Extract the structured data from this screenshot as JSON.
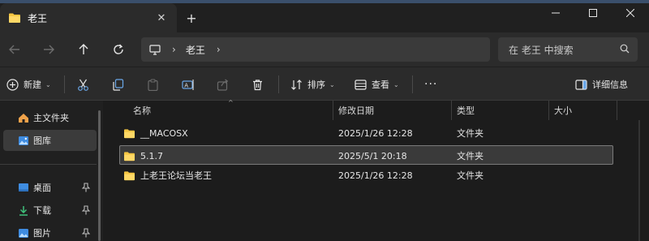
{
  "window": {
    "tab_title": "老王"
  },
  "navigation": {
    "breadcrumb": [
      "老王"
    ],
    "search_placeholder": "在 老王 中搜索"
  },
  "command_bar": {
    "new_label": "新建",
    "sort_label": "排序",
    "view_label": "查看",
    "more_label": "···",
    "details_label": "详细信息"
  },
  "sidebar": {
    "items": [
      {
        "label": "主文件夹",
        "icon": "home-icon"
      },
      {
        "label": "图库",
        "icon": "gallery-icon"
      },
      {
        "label": "桌面",
        "icon": "desktop-icon",
        "pinned": true
      },
      {
        "label": "下载",
        "icon": "download-icon",
        "pinned": true
      },
      {
        "label": "图片",
        "icon": "pictures-icon",
        "pinned": true
      }
    ]
  },
  "file_list": {
    "columns": [
      "名称",
      "修改日期",
      "类型",
      "大小"
    ],
    "rows": [
      {
        "name": "__MACOSX",
        "modified": "2025/1/26 12:28",
        "type": "文件夹",
        "size": "",
        "selected": false
      },
      {
        "name": "5.1.7",
        "modified": "2025/5/1 20:18",
        "type": "文件夹",
        "size": "",
        "selected": true
      },
      {
        "name": "上老王论坛当老王",
        "modified": "2025/1/26 12:28",
        "type": "文件夹",
        "size": "",
        "selected": false
      }
    ]
  },
  "colors": {
    "folder": "#f4c542",
    "background": "#1c1c1c",
    "toolbar": "#2b2b2b"
  }
}
